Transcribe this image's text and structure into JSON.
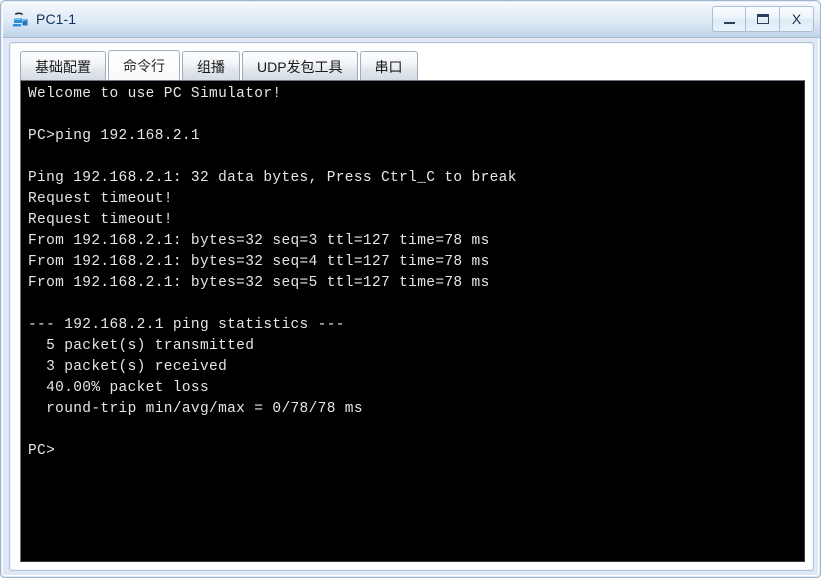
{
  "window": {
    "title": "PC1-1",
    "icon": "pc-simulator-icon",
    "controls": {
      "minimize": "_",
      "maximize": "□",
      "close": "X"
    }
  },
  "tabs": [
    {
      "label": "基础配置",
      "name": "tab-basic-config",
      "active": false
    },
    {
      "label": "命令行",
      "name": "tab-command-line",
      "active": true
    },
    {
      "label": "组播",
      "name": "tab-multicast",
      "active": false
    },
    {
      "label": "UDP发包工具",
      "name": "tab-udp-tool",
      "active": false
    },
    {
      "label": "串口",
      "name": "tab-serial-port",
      "active": false
    }
  ],
  "terminal": {
    "lines": [
      "Welcome to use PC Simulator!",
      "",
      "PC>ping 192.168.2.1",
      "",
      "Ping 192.168.2.1: 32 data bytes, Press Ctrl_C to break",
      "Request timeout!",
      "Request timeout!",
      "From 192.168.2.1: bytes=32 seq=3 ttl=127 time=78 ms",
      "From 192.168.2.1: bytes=32 seq=4 ttl=127 time=78 ms",
      "From 192.168.2.1: bytes=32 seq=5 ttl=127 time=78 ms",
      "",
      "--- 192.168.2.1 ping statistics ---",
      "  5 packet(s) transmitted",
      "  3 packet(s) received",
      "  40.00% packet loss",
      "  round-trip min/avg/max = 0/78/78 ms",
      "",
      "PC>"
    ],
    "prompt": "PC>",
    "target_host": "192.168.2.1",
    "packets_transmitted": 5,
    "packets_received": 3,
    "packet_loss_percent": "40.00%",
    "round_trip_min_avg_max_ms": "0/78/78",
    "data_bytes": 32,
    "ttl": 127
  },
  "colors": {
    "terminal_bg": "#000000",
    "terminal_fg": "#e6e6e6",
    "title_accent": "#c6d9ec",
    "panel_bg": "#eef3fb"
  }
}
